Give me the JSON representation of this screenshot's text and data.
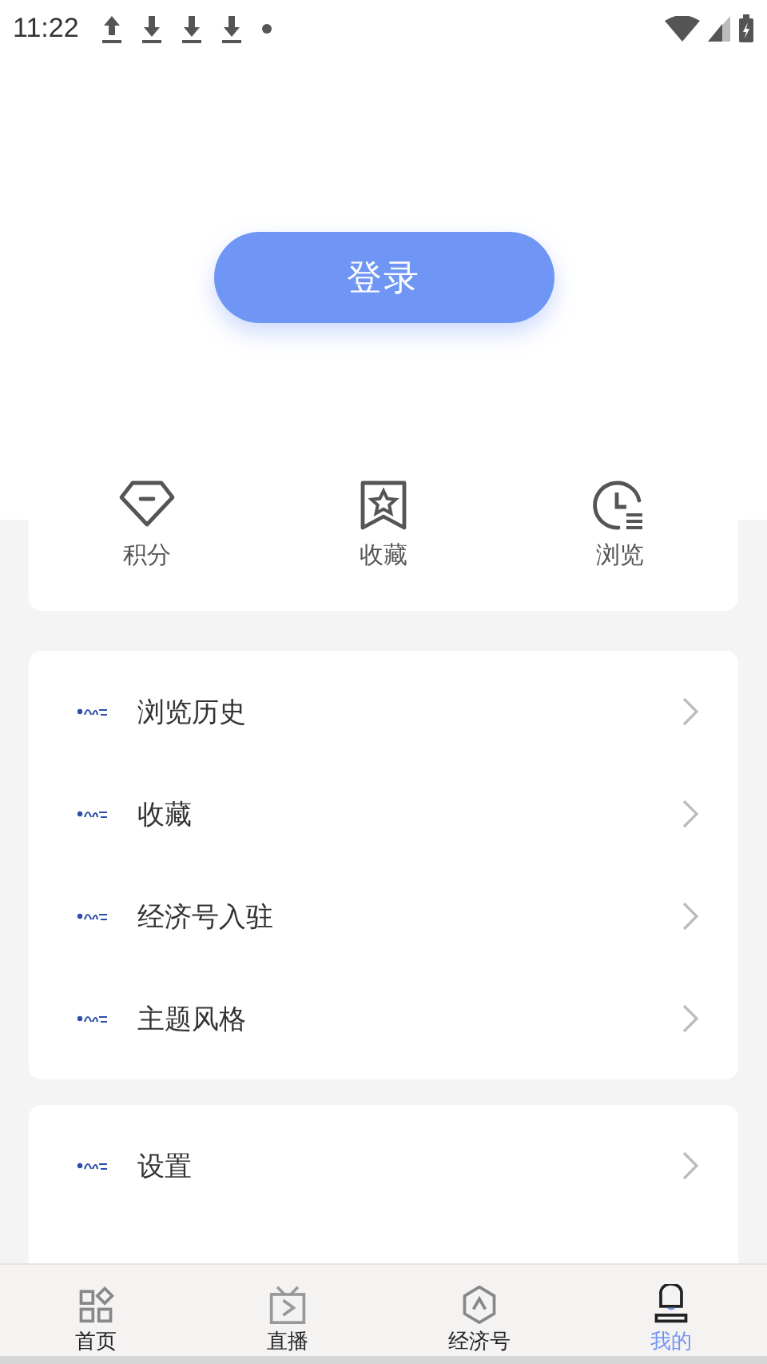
{
  "status_bar": {
    "time": "11:22"
  },
  "login_button": {
    "label": "登录"
  },
  "shortcuts": [
    {
      "kind": "points",
      "label": "积分"
    },
    {
      "kind": "favorites",
      "label": "收藏"
    },
    {
      "kind": "history",
      "label": "浏览"
    }
  ],
  "menu_groups": [
    {
      "items": [
        {
          "label": "浏览历史"
        },
        {
          "label": "收藏"
        },
        {
          "label": "经济号入驻"
        },
        {
          "label": "主题风格"
        }
      ]
    },
    {
      "items": [
        {
          "label": "设置"
        }
      ]
    }
  ],
  "tabs": [
    {
      "kind": "home",
      "label": "首页",
      "selected": false
    },
    {
      "kind": "live",
      "label": "直播",
      "selected": false
    },
    {
      "kind": "channel",
      "label": "经济号",
      "selected": false
    },
    {
      "kind": "me",
      "label": "我的",
      "selected": true
    }
  ]
}
